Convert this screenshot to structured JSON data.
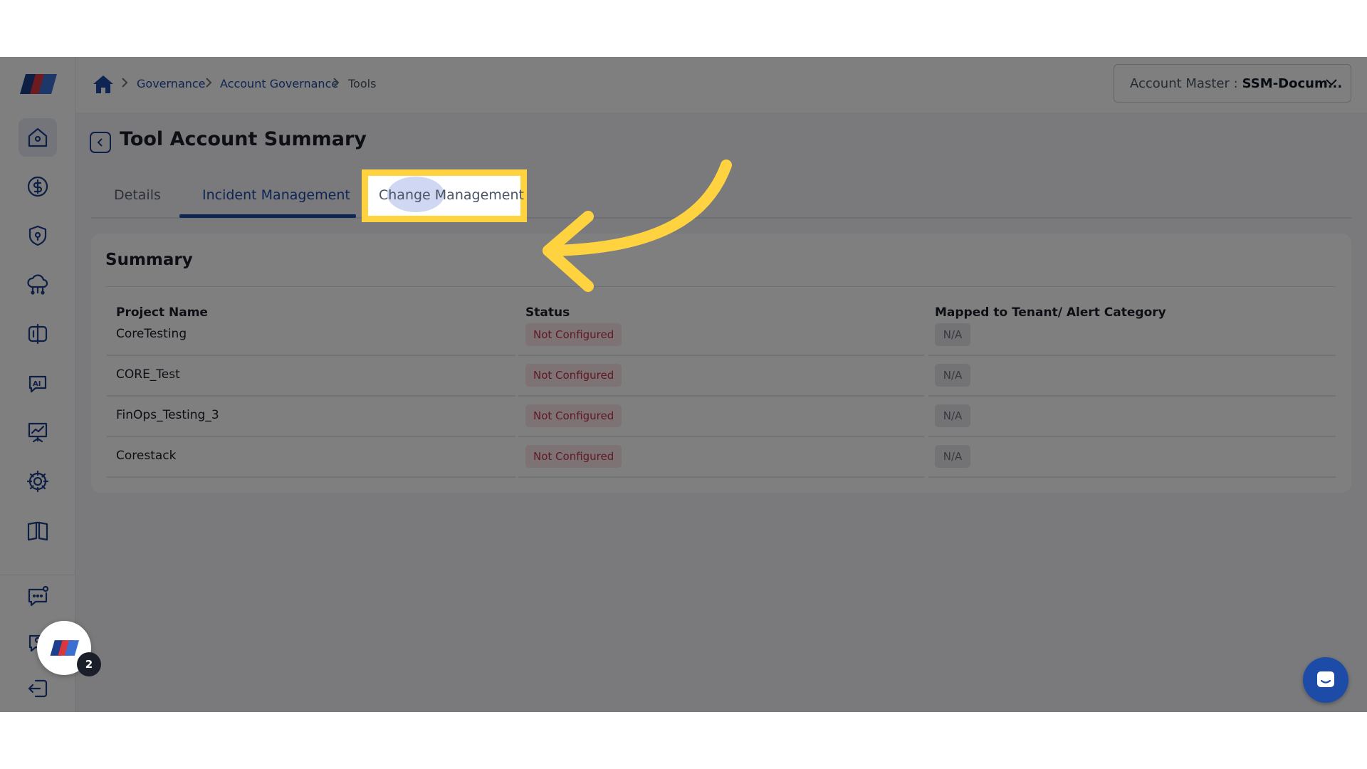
{
  "breadcrumb": {
    "items": [
      "Governance",
      "Account Governance",
      "Tools"
    ]
  },
  "account_selector": {
    "label": "Account Master :",
    "value": "SSM-Docum..."
  },
  "page": {
    "title": "Tool Account Summary"
  },
  "tabs": [
    {
      "label": "Details"
    },
    {
      "label": "Incident Management"
    },
    {
      "label": "Change Management"
    }
  ],
  "summary": {
    "title": "Summary",
    "columns": [
      "Project Name",
      "Status",
      "Mapped to Tenant/ Alert Category"
    ],
    "rows": [
      {
        "project": "CoreTesting",
        "status": "Not Configured",
        "mapped": "N/A"
      },
      {
        "project": "CORE_Test",
        "status": "Not Configured",
        "mapped": "N/A"
      },
      {
        "project": "FinOps_Testing_3",
        "status": "Not Configured",
        "mapped": "N/A"
      },
      {
        "project": "Corestack",
        "status": "Not Configured",
        "mapped": "N/A"
      }
    ]
  },
  "assistant": {
    "badge_count": "2"
  },
  "colors": {
    "accent": "#1d4ba8",
    "highlight": "#ffd23f",
    "status_error": "#c0304b"
  },
  "sidebar_icons": [
    "home-icon",
    "billing-icon",
    "security-shield-icon",
    "cloud-network-icon",
    "compare-icon",
    "ai-chat-icon",
    "presentation-chart-icon",
    "settings-gear-icon",
    "book-icon",
    "feedback-chat-icon",
    "support-icon",
    "logout-icon"
  ]
}
